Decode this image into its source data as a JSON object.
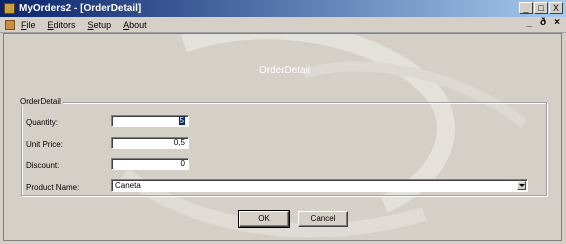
{
  "window": {
    "title": "MyOrders2 - [OrderDetail]",
    "controls": [
      "_",
      "□",
      "X"
    ]
  },
  "menu": {
    "items": [
      "File",
      "Editors",
      "Setup",
      "About"
    ],
    "mdi_controls": [
      "_",
      "ð",
      "×"
    ]
  },
  "form": {
    "title": "OrderDetail",
    "group_label": "OrderDetail",
    "quantity_label": "Quantity:",
    "quantity_value": "5",
    "unit_price_label": "Unit Price:",
    "unit_price_value": "0,5",
    "discount_label": "Discount:",
    "discount_value": "0",
    "product_name_label": "Product Name:",
    "product_name_value": "Caneta"
  },
  "buttons": {
    "ok": "OK",
    "cancel": "Cancel"
  },
  "colors": {
    "titlebar_start": "#0a246a",
    "titlebar_end": "#a6caf0",
    "face": "#d4d0c8"
  }
}
